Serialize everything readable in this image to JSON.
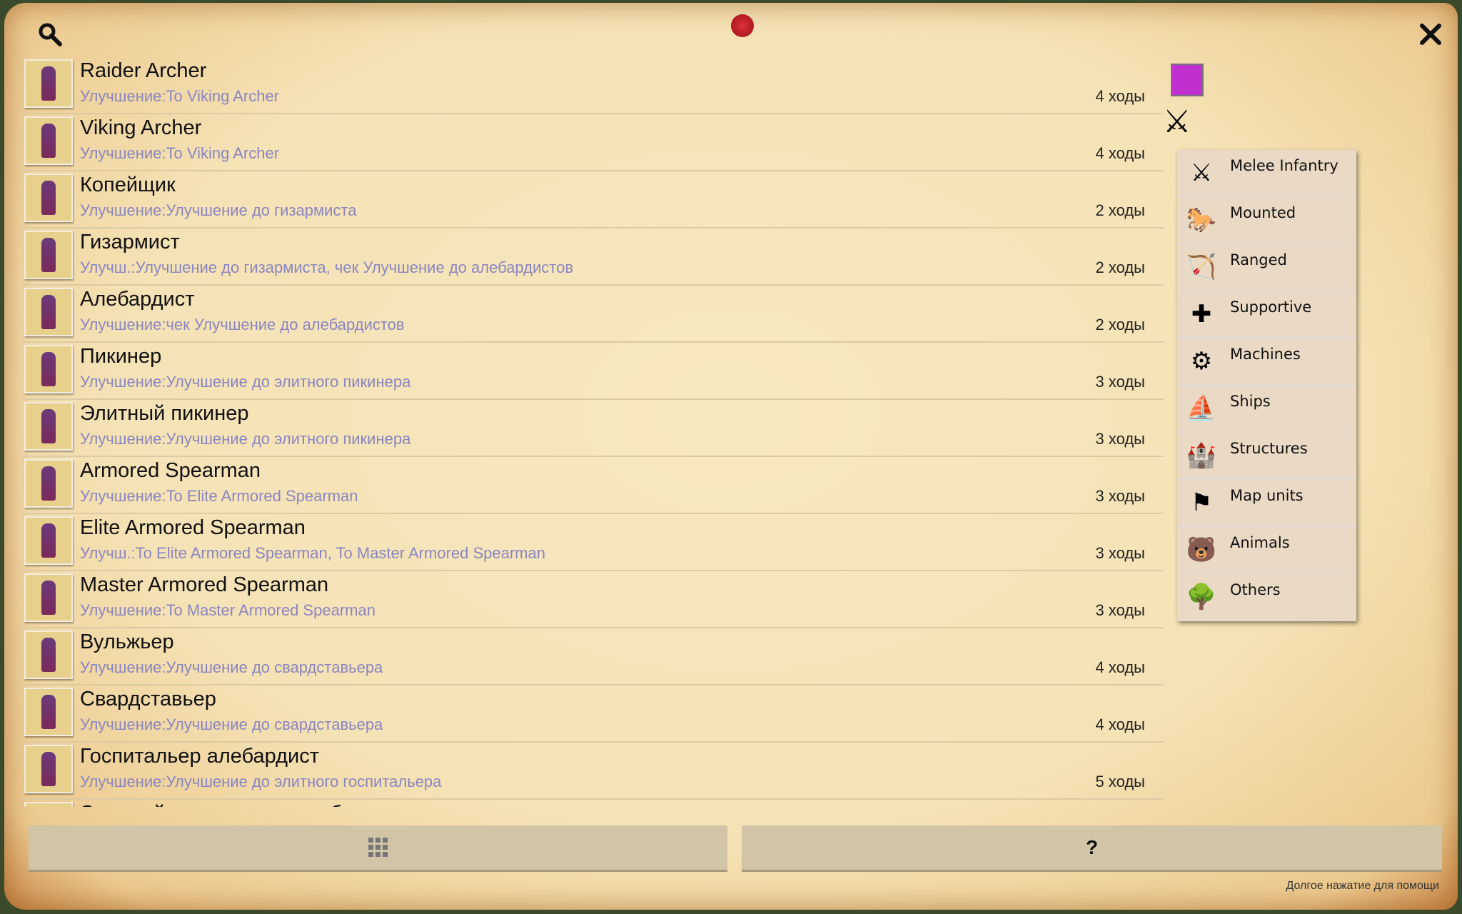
{
  "header": {
    "search_icon": "magnifier-icon",
    "close_icon": "close-x-icon"
  },
  "units": [
    {
      "name": "Raider Archer",
      "upgrade": "Улучшение:To Viking Archer",
      "turns": "4 ходы"
    },
    {
      "name": "Viking Archer",
      "upgrade": "Улучшение:To Viking Archer",
      "turns": "4 ходы"
    },
    {
      "name": "Копейщик",
      "upgrade": "Улучшение:Улучшение до гизармиста",
      "turns": "2 ходы"
    },
    {
      "name": "Гизармист",
      "upgrade": "Улучш.:Улучшение до гизармиста, чек Улучшение до алебардистов",
      "turns": "2 ходы"
    },
    {
      "name": "Алебардист",
      "upgrade": "Улучшение:чек Улучшение до алебардистов",
      "turns": "2 ходы"
    },
    {
      "name": "Пикинер",
      "upgrade": "Улучшение:Улучшение до элитного пикинера",
      "turns": "3 ходы"
    },
    {
      "name": "Элитный пикинер",
      "upgrade": "Улучшение:Улучшение до элитного пикинера",
      "turns": "3 ходы"
    },
    {
      "name": "Armored Spearman",
      "upgrade": "Улучшение:To Elite Armored Spearman",
      "turns": "3 ходы"
    },
    {
      "name": "Elite Armored Spearman",
      "upgrade": "Улучш.:To Elite Armored Spearman, To Master Armored Spearman",
      "turns": "3 ходы"
    },
    {
      "name": "Master Armored Spearman",
      "upgrade": "Улучшение:To Master Armored Spearman",
      "turns": "3 ходы"
    },
    {
      "name": "Вульжьер",
      "upgrade": "Улучшение:Улучшение до свардставьера",
      "turns": "4 ходы"
    },
    {
      "name": "Свардставьер",
      "upgrade": "Улучшение:Улучшение до свардставьера",
      "turns": "4 ходы"
    },
    {
      "name": "Госпитальер алебардист",
      "upgrade": "Улучшение:Улучшение до элитного госпитальера",
      "turns": "5 ходы"
    },
    {
      "name": "Элитный госпитальер алебардист",
      "upgrade": "",
      "turns": ""
    }
  ],
  "player_color": "#c030d0",
  "category_menu": {
    "selected": "Melee Infantry",
    "items": [
      {
        "label": "Melee Infantry",
        "icon": "⚔"
      },
      {
        "label": "Mounted",
        "icon": "🐎"
      },
      {
        "label": "Ranged",
        "icon": "🏹"
      },
      {
        "label": "Supportive",
        "icon": "✚"
      },
      {
        "label": "Machines",
        "icon": "⚙"
      },
      {
        "label": "Ships",
        "icon": "⛵"
      },
      {
        "label": "Structures",
        "icon": "🏰"
      },
      {
        "label": "Map units",
        "icon": "⚑"
      },
      {
        "label": "Animals",
        "icon": "🐻"
      },
      {
        "label": "Others",
        "icon": "🌳"
      }
    ]
  },
  "footer": {
    "grid_button_icon": "grid-icon",
    "help_button_label": "?",
    "hint": "Долгое нажатие для помощи"
  }
}
